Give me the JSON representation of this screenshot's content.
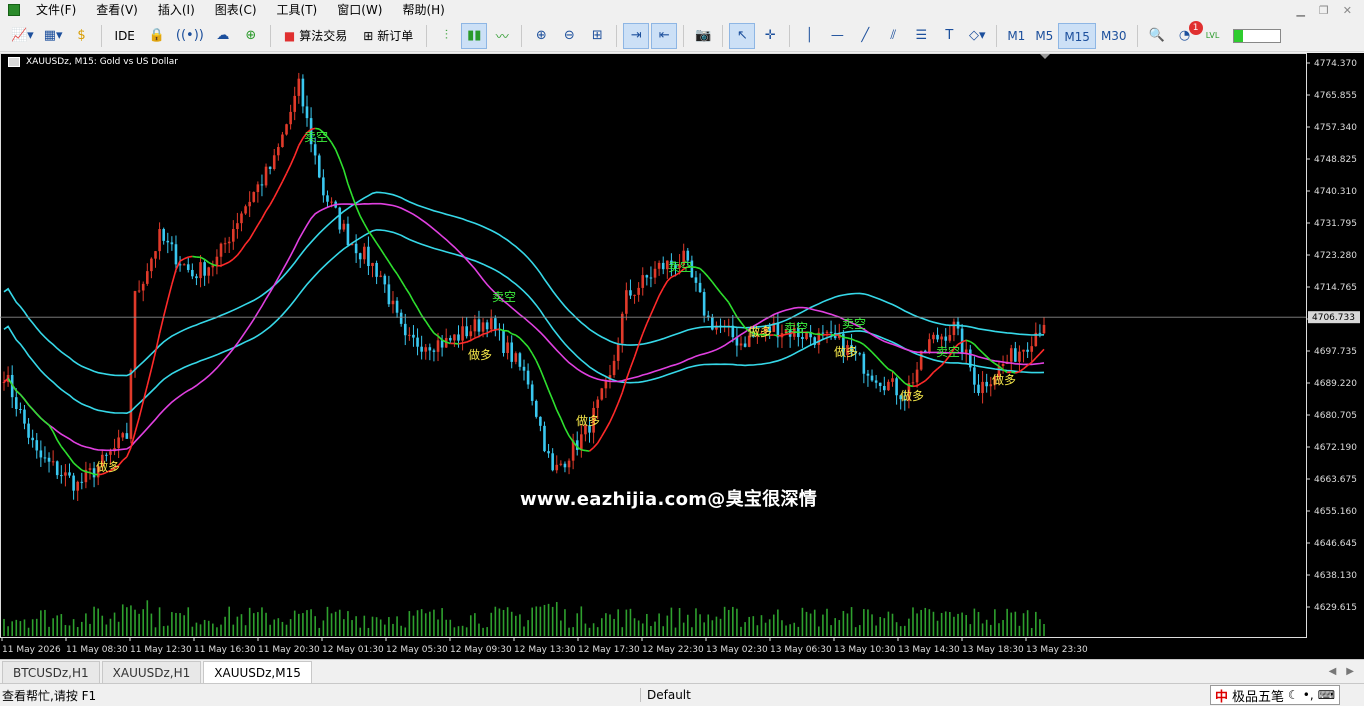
{
  "menu": [
    "文件(F)",
    "查看(V)",
    "插入(I)",
    "图表(C)",
    "工具(T)",
    "窗口(W)",
    "帮助(H)"
  ],
  "toolbar": {
    "ide_label": "IDE",
    "algo_label": "算法交易",
    "new_order_label": "新订单",
    "timeframes": [
      "M1",
      "M5",
      "M15",
      "M30"
    ],
    "active_timeframe": "M15",
    "notification_count": "1",
    "level_label": "LVL"
  },
  "chart": {
    "title": "XAUUSDz, M15:  Gold vs US Dollar",
    "watermark": "www.eazhijia.com@臭宝很深情",
    "current_price": "4706.733",
    "price_levels": [
      "4774.370",
      "4765.855",
      "4757.340",
      "4748.825",
      "4740.310",
      "4731.795",
      "4723.280",
      "4714.765",
      "4706.250",
      "4697.735",
      "4689.220",
      "4680.705",
      "4672.190",
      "4663.675",
      "4655.160",
      "4646.645",
      "4638.130",
      "4629.615"
    ],
    "time_labels": [
      "11 May 2026",
      "11 May 08:30",
      "11 May 12:30",
      "11 May 16:30",
      "11 May 20:30",
      "12 May 01:30",
      "12 May 05:30",
      "12 May 09:30",
      "12 May 13:30",
      "12 May 17:30",
      "12 May 22:30",
      "13 May 02:30",
      "13 May 06:30",
      "13 May 10:30",
      "13 May 14:30",
      "13 May 18:30",
      "13 May 23:30"
    ],
    "signals": [
      {
        "text": "做多"
      },
      {
        "text": "卖空"
      },
      {
        "text": "卖空"
      },
      {
        "text": "做多"
      },
      {
        "text": "做多"
      },
      {
        "text": "卖空"
      },
      {
        "text": "做多"
      },
      {
        "text": "卖空"
      },
      {
        "text": "卖空"
      },
      {
        "text": "做多"
      },
      {
        "text": "卖空"
      },
      {
        "text": "做多"
      },
      {
        "text": "做多"
      }
    ],
    "colors": {
      "up": "#e03a2a",
      "down": "#3ac8f0",
      "ma_slow": "#36d8e8",
      "ma_mid": "#e040e0",
      "signal_text": "#f6e84a",
      "signal_short": "#3ef03e",
      "line_green": "#2ee02e",
      "line_red": "#ff2a2a",
      "volume": "#2ea02e"
    }
  },
  "tabs": [
    {
      "label": "BTCUSDz,H1"
    },
    {
      "label": "XAUUSDz,H1"
    },
    {
      "label": "XAUUSDz,M15"
    }
  ],
  "active_tab": "XAUUSDz,M15",
  "status": {
    "help": "查看帮忙,请按 F1",
    "profile": "Default"
  },
  "ime": {
    "logo": "中",
    "name": "极品五笔"
  }
}
